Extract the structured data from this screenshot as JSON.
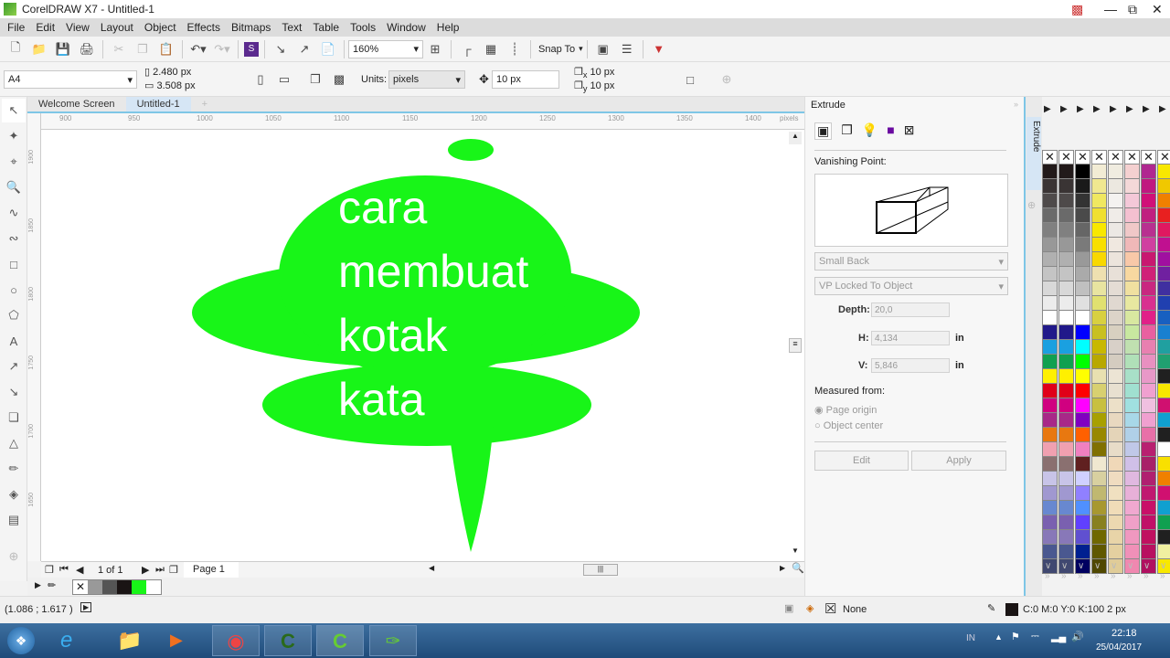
{
  "window": {
    "title": "CorelDRAW X7 - Untitled-1"
  },
  "menu": [
    "File",
    "Edit",
    "View",
    "Layout",
    "Object",
    "Effects",
    "Bitmaps",
    "Text",
    "Table",
    "Tools",
    "Window",
    "Help"
  ],
  "toolbar": {
    "zoom": "160%",
    "snap_to": "Snap To"
  },
  "property_bar": {
    "page_size": "A4",
    "width": "2.480 px",
    "height": "3.508 px",
    "units_label": "Units:",
    "units": "pixels",
    "nudge": "10 px",
    "dup_x": "10 px",
    "dup_y": "10 px"
  },
  "tabs": [
    "Welcome Screen",
    "Untitled-1"
  ],
  "ruler": {
    "h_ticks": [
      "900",
      "950",
      "1000",
      "1050",
      "1100",
      "1150",
      "1200",
      "1250",
      "1300",
      "1350",
      "1400"
    ],
    "h_unit": "pixels",
    "v_ticks": [
      "1900",
      "1850",
      "1800",
      "1750",
      "1700",
      "1650"
    ],
    "v_unit": "pixels"
  },
  "canvas": {
    "shape_color": "#18f518",
    "text_lines": [
      "cara",
      "membuat",
      "kotak",
      "kata"
    ]
  },
  "docker": {
    "title": "Extrude",
    "vanishing_label": "Vanishing Point:",
    "type": "Small Back",
    "vp_mode": "VP Locked To Object",
    "depth_label": "Depth:",
    "depth": "20,0",
    "h_label": "H:",
    "h": "4,134",
    "v_label": "V:",
    "v": "5,846",
    "unit": "in",
    "measured_label": "Measured from:",
    "opt1": "Page origin",
    "opt2": "Object center",
    "edit": "Edit",
    "apply": "Apply",
    "strip_label": "Extrude"
  },
  "pagebar": {
    "counter": "1 of 1",
    "page_tab": "Page 1"
  },
  "status": {
    "coords": "(1.086 ; 1.617 )",
    "fill": "None",
    "outline": "C:0 M:0 Y:0 K:100  2 px"
  },
  "taskbar": {
    "lang": "IN",
    "time": "22:18",
    "date": "25/04/2017"
  }
}
